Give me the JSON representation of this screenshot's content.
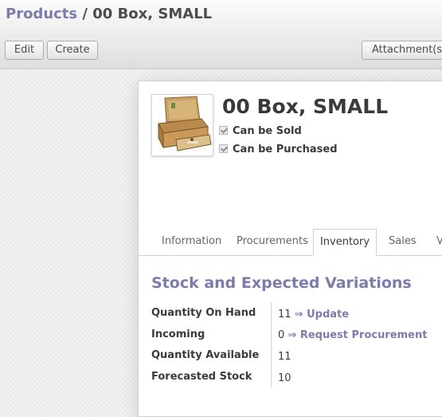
{
  "breadcrumb": {
    "parent": "Products",
    "separator": "/",
    "current": "00 Box, SMALL"
  },
  "toolbar": {
    "edit_label": "Edit",
    "create_label": "Create",
    "attachments_label": "Attachment(s)"
  },
  "product": {
    "name": "00 Box, SMALL",
    "can_be_sold_label": "Can be Sold",
    "can_be_sold": true,
    "can_be_purchased_label": "Can be Purchased",
    "can_be_purchased": true
  },
  "tabs": [
    {
      "label": "Information"
    },
    {
      "label": "Procurements"
    },
    {
      "label": "Inventory",
      "active": true
    },
    {
      "label": "Sales"
    },
    {
      "label": "V"
    }
  ],
  "inventory": {
    "section_title": "Stock and Expected Variations",
    "fields": [
      {
        "label": "Quantity On Hand",
        "value": "11",
        "action": "⇒ Update"
      },
      {
        "label": "Incoming",
        "value": "0",
        "action": "⇒ Request Procurement"
      },
      {
        "label": "Quantity Available",
        "value": "11"
      },
      {
        "label": "Forecasted Stock",
        "value": "10"
      }
    ]
  },
  "colors": {
    "accent": "#7c7bad",
    "text": "#4c4c4c"
  }
}
